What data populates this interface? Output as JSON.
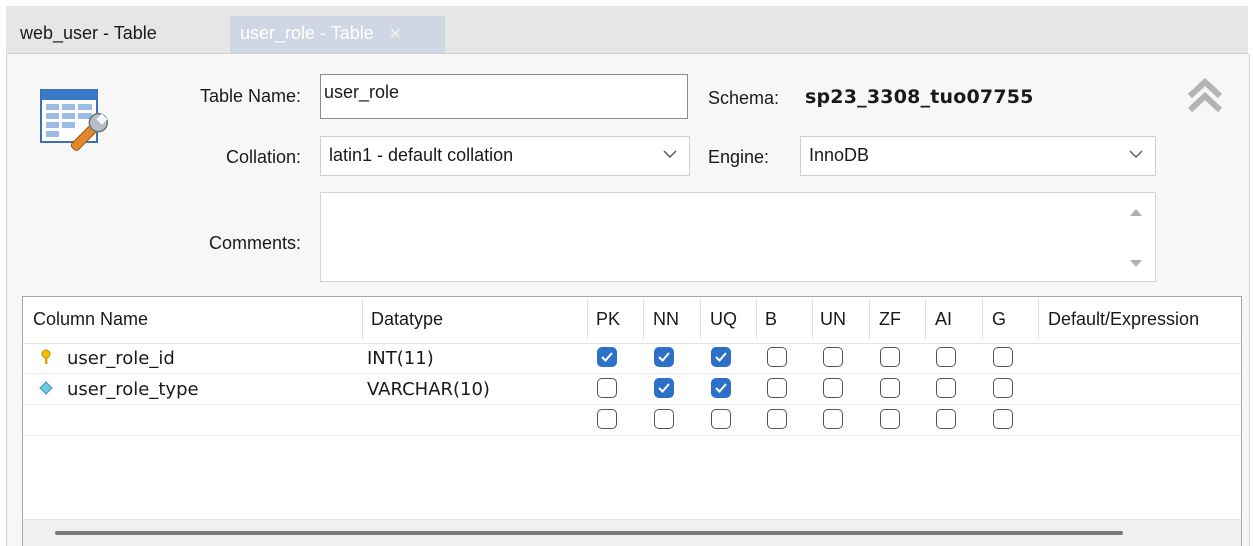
{
  "tabs": [
    {
      "label": "web_user - Table",
      "active": false
    },
    {
      "label": "user_role - Table",
      "active": true,
      "close_glyph": "✕"
    }
  ],
  "form": {
    "table_name_label": "Table Name:",
    "table_name_value": "user_role",
    "schema_label": "Schema:",
    "schema_value": "sp23_3308_tuo07755",
    "collation_label": "Collation:",
    "collation_value": "latin1 - default collation",
    "engine_label": "Engine:",
    "engine_value": "InnoDB",
    "comments_label": "Comments:",
    "comments_value": ""
  },
  "icons": {
    "table_settings": "table-settings-icon",
    "collapse": "double-chevron-up-icon",
    "dropdown": "chevron-down-icon",
    "primary_key": "key-icon",
    "column": "diamond-icon"
  },
  "colors": {
    "checked": "#2d70c8",
    "active_tab": "#cfd7e5"
  },
  "grid": {
    "headers": [
      "Column Name",
      "Datatype",
      "PK",
      "NN",
      "UQ",
      "B",
      "UN",
      "ZF",
      "AI",
      "G",
      "Default/Expression"
    ],
    "rows": [
      {
        "name": "user_role_id",
        "datatype": "INT(11)",
        "icon": "key-icon",
        "flags": [
          true,
          true,
          true,
          false,
          false,
          false,
          false,
          false
        ],
        "default": ""
      },
      {
        "name": "user_role_type",
        "datatype": "VARCHAR(10)",
        "icon": "diamond-icon",
        "flags": [
          false,
          true,
          true,
          false,
          false,
          false,
          false,
          false
        ],
        "default": ""
      },
      {
        "name": "",
        "datatype": "",
        "icon": "",
        "flags": [
          false,
          false,
          false,
          false,
          false,
          false,
          false,
          false
        ],
        "default": ""
      }
    ]
  }
}
